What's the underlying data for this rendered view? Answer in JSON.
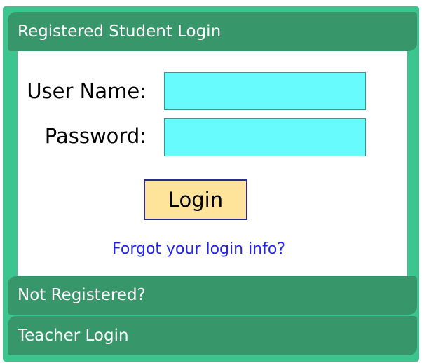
{
  "panels": {
    "student_login": {
      "title": "Registered Student Login",
      "username_label": "User Name:",
      "username_value": "",
      "password_label": "Password:",
      "password_value": "",
      "login_button": "Login",
      "forgot_link": "Forgot your login info?"
    },
    "not_registered": {
      "title": "Not Registered?"
    },
    "teacher_login": {
      "title": "Teacher Login"
    }
  },
  "colors": {
    "frame_green": "#3cc58f",
    "header_green": "#37976a",
    "input_cyan": "#67fbfd",
    "button_yellow": "#fde49a",
    "link_blue": "#2323e8"
  }
}
